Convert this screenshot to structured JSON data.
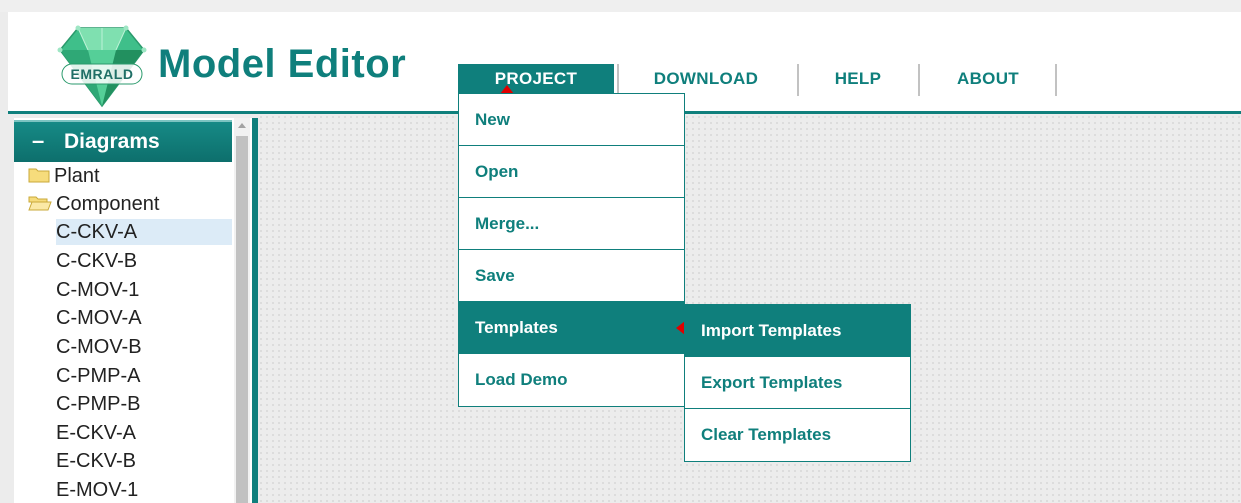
{
  "app": {
    "logo_text": "EMRALD",
    "title": "Model Editor"
  },
  "nav": {
    "items": [
      {
        "label": "PROJECT",
        "active": true
      },
      {
        "label": "DOWNLOAD",
        "active": false
      },
      {
        "label": "HELP",
        "active": false
      },
      {
        "label": "ABOUT",
        "active": false
      }
    ]
  },
  "sidebar": {
    "collapse_symbol": "–",
    "title": "Diagrams",
    "tree": [
      {
        "label": "Plant",
        "type": "folder",
        "open": false
      },
      {
        "label": "Component",
        "type": "folder",
        "open": true
      },
      {
        "label": "C-CKV-A",
        "type": "item",
        "selected": true
      },
      {
        "label": "C-CKV-B",
        "type": "item"
      },
      {
        "label": "C-MOV-1",
        "type": "item"
      },
      {
        "label": "C-MOV-A",
        "type": "item"
      },
      {
        "label": "C-MOV-B",
        "type": "item"
      },
      {
        "label": "C-PMP-A",
        "type": "item"
      },
      {
        "label": "C-PMP-B",
        "type": "item"
      },
      {
        "label": "E-CKV-A",
        "type": "item"
      },
      {
        "label": "E-CKV-B",
        "type": "item"
      },
      {
        "label": "E-MOV-1",
        "type": "item"
      }
    ]
  },
  "project_menu": {
    "items": [
      "New",
      "Open",
      "Merge...",
      "Save",
      "Templates",
      "Load Demo"
    ],
    "active": "Templates"
  },
  "templates_submenu": {
    "items": [
      "Import Templates",
      "Export Templates",
      "Clear Templates"
    ],
    "active": "Import Templates"
  },
  "colors": {
    "accent": "#0f7f7c",
    "marker": "#e00000",
    "selected_row": "#dcebf7"
  },
  "icons": {
    "logo": "emerald-gem-icon",
    "folder": "folder-icon",
    "folder_open": "folder-open-icon",
    "scroll_up": "scroll-up-arrow-icon",
    "caret": "red-caret-icon"
  }
}
